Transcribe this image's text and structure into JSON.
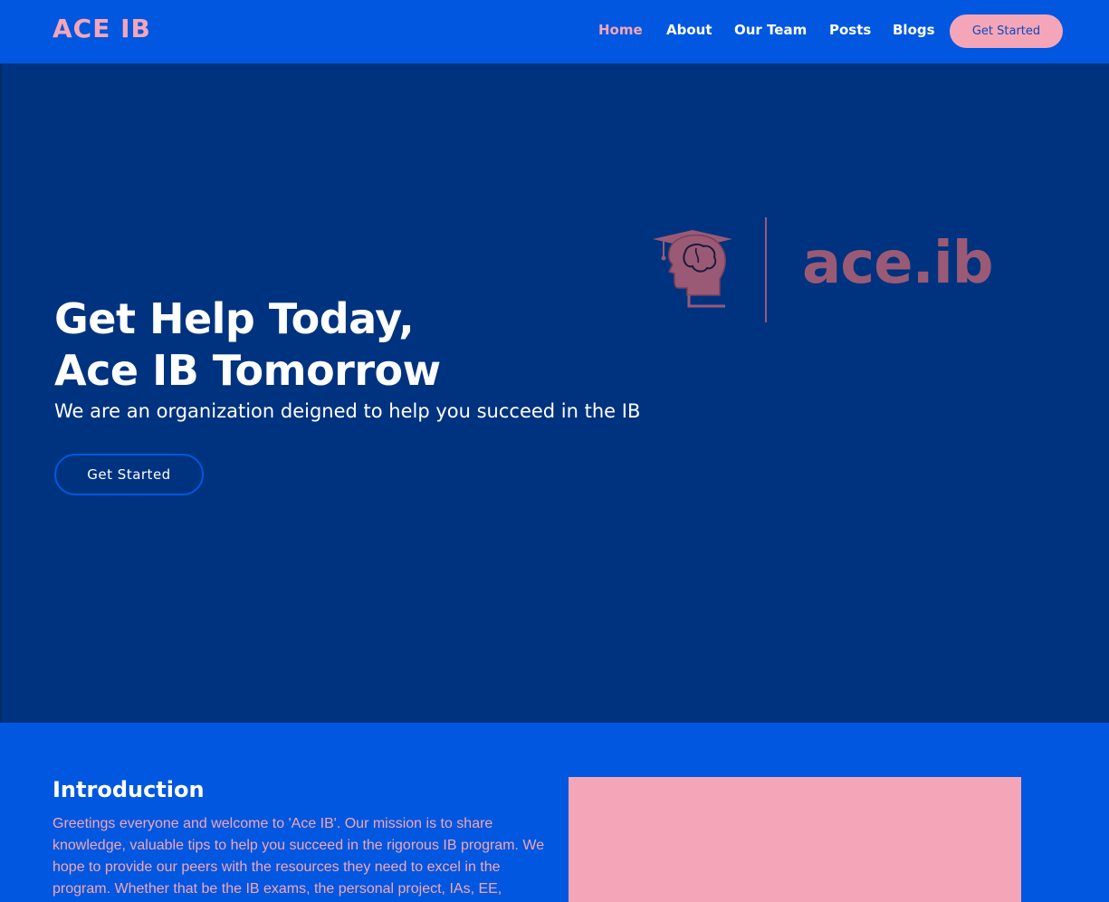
{
  "header": {
    "brand": "ACE IB",
    "nav": [
      {
        "label": "Home"
      },
      {
        "label": "About"
      },
      {
        "label": "Our Team"
      },
      {
        "label": "Posts"
      },
      {
        "label": "Blogs"
      }
    ],
    "cta": "Get Started"
  },
  "hero": {
    "title_line1": "Get Help Today,",
    "title_line2": "Ace IB Tomorrow",
    "subtitle": "We are an organization deigned to help you succeed in the IB",
    "cta": "Get Started",
    "logo_text": "ace.ib"
  },
  "intro": {
    "title": "Introduction",
    "text": "Greetings everyone and welcome to 'Ace IB'. Our mission is to share knowledge, valuable tips to help you succeed in the rigorous IB program. We hope to provide our peers with the resources they need to excel in the program. Whether that be the IB exams, the personal project, IAs, EE,"
  },
  "colors": {
    "primary_blue": "#0157df",
    "hero_navy": "#00337f",
    "accent_pink": "#f4a6b8",
    "logo_mauve": "#9a5a75"
  }
}
